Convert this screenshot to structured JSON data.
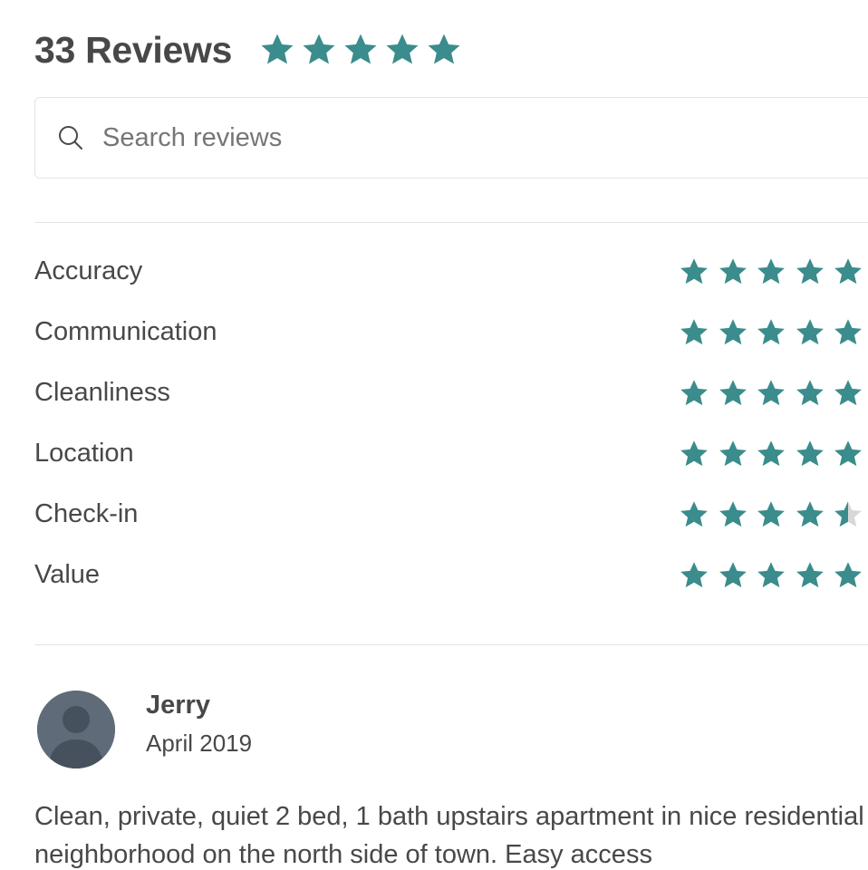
{
  "colors": {
    "accent": "#3b8c8c",
    "text": "#484848",
    "muted": "#767676",
    "divider": "#e4e4e4",
    "avatar": "#5f6b78",
    "empty_star": "#d8d8d8"
  },
  "header": {
    "title": "33 Reviews",
    "overall_rating": 5
  },
  "search": {
    "icon": "search-icon",
    "placeholder": "Search reviews",
    "value": ""
  },
  "categories": [
    {
      "label": "Accuracy",
      "rating": 5
    },
    {
      "label": "Communication",
      "rating": 5
    },
    {
      "label": "Cleanliness",
      "rating": 5
    },
    {
      "label": "Location",
      "rating": 5
    },
    {
      "label": "Check-in",
      "rating": 4.5
    },
    {
      "label": "Value",
      "rating": 5
    }
  ],
  "review": {
    "avatar_icon": "user-avatar-icon",
    "name": "Jerry",
    "date": "April 2019",
    "text": "Clean, private, quiet 2 bed, 1 bath upstairs apartment in nice residential neighborhood on the north side of town. Easy access"
  }
}
